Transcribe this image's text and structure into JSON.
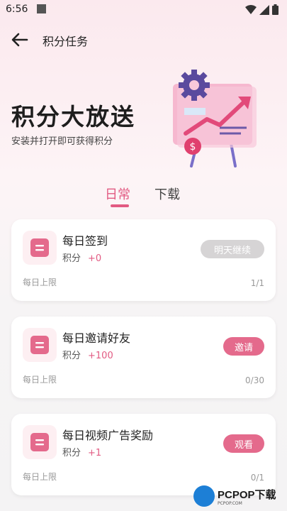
{
  "status_bar": {
    "time": "6:56"
  },
  "header": {
    "title": "积分任务"
  },
  "hero": {
    "title": "积分大放送",
    "subtitle": "安装并打开即可获得积分"
  },
  "tabs": [
    {
      "label": "日常",
      "active": true
    },
    {
      "label": "下载",
      "active": false
    }
  ],
  "tasks": [
    {
      "title": "每日签到",
      "points_label": "积分",
      "points": "+0",
      "button": "明天继续",
      "limit_label": "每日上限",
      "count": "1/1"
    },
    {
      "title": "每日邀请好友",
      "points_label": "积分",
      "points": "+100",
      "button": "邀请",
      "limit_label": "每日上限",
      "count": "0/30"
    },
    {
      "title": "每日视频广告奖励",
      "points_label": "积分",
      "points": "+1",
      "button": "观看",
      "limit_label": "每日上限",
      "count": "0/1"
    }
  ],
  "watermark": {
    "brand": "PCPOP下载",
    "tagline": "PCPOP.COM"
  },
  "colors": {
    "accent": "#e25a82",
    "button_active": "#e46a8c",
    "button_done": "#d6d4d5"
  },
  "icons": [
    "back-arrow-icon",
    "task-list-icon",
    "gear-icon",
    "dollar-icon",
    "wifi-icon",
    "signal-icon",
    "battery-icon"
  ]
}
